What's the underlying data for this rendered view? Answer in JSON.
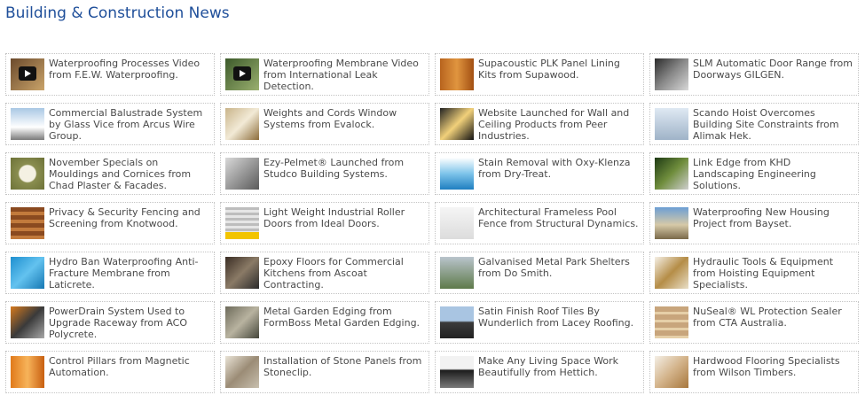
{
  "page": {
    "title": "Building & Construction News"
  },
  "items": [
    {
      "text": "Waterproofing Processes Video from F.E.W. Waterproofing.",
      "thumb": "video-thumb",
      "bg": "linear-gradient(135deg,#6b4a2c,#caa46a)"
    },
    {
      "text": "Waterproofing Membrane Video from International Leak Detection.",
      "thumb": "video-thumb",
      "bg": "linear-gradient(135deg,#3c5a2a,#9bb070)"
    },
    {
      "text": "Supacoustic PLK Panel Lining Kits from Supawood.",
      "thumb": "panel-thumb",
      "bg": "linear-gradient(90deg,#b8641e,#e0953f,#a24f12)"
    },
    {
      "text": "SLM Automatic Door Range from Doorways GILGEN.",
      "thumb": "door-thumb",
      "bg": "linear-gradient(135deg,#2b2b2b,#8a8a8a,#d8d8d8)"
    },
    {
      "text": "Commercial Balustrade System by Glass Vice from Arcus Wire Group.",
      "thumb": "balustrade-thumb",
      "bg": "linear-gradient(180deg,#a9c8e4,#ffffff 60%,#7a7a7a)"
    },
    {
      "text": "Weights and Cords Window Systems from Evalock.",
      "thumb": "window-thumb",
      "bg": "linear-gradient(135deg,#c9b48a,#f2ead6,#8c6c3a)"
    },
    {
      "text": "Website Launched for Wall and Ceiling Products from Peer Industries.",
      "thumb": "website-thumb",
      "bg": "linear-gradient(135deg,#222,#f1d07a 50%,#111)"
    },
    {
      "text": "Scando Hoist Overcomes Building Site Constraints from Alimak Hek.",
      "thumb": "hoist-thumb",
      "bg": "linear-gradient(180deg,#dfe9f3,#9fb3c8)"
    },
    {
      "text": "November Specials on Mouldings and Cornices from Chad Plaster & Facades.",
      "thumb": "moulding-thumb",
      "bg": "radial-gradient(circle,#f4f1e3 35%,#8a8e50 40%,#6d7238)"
    },
    {
      "text": "Ezy-Pelmet® Launched from Studco Building Systems.",
      "thumb": "pelmet-thumb",
      "bg": "linear-gradient(135deg,#d9d9d9,#5a5a5a)"
    },
    {
      "text": "Stain Removal with Oxy-Klenza from Dry-Treat.",
      "thumb": "product-thumb",
      "bg": "linear-gradient(180deg,#ffffff,#7ec4ea 50%,#1f7fc0)"
    },
    {
      "text": "Link Edge from KHD Landscaping Engineering Solutions.",
      "thumb": "edge-thumb",
      "bg": "linear-gradient(135deg,#1e3a14,#6f8d3c,#cfcfcf)"
    },
    {
      "text": "Privacy & Security Fencing and Screening from Knotwood.",
      "thumb": "fence-thumb",
      "bg": "repeating-linear-gradient(180deg,#8a4a20 0 5px,#c27a3c 5px 9px)"
    },
    {
      "text": "Light Weight Industrial Roller Doors from Ideal Doors.",
      "thumb": "roller-thumb",
      "bg": "repeating-linear-gradient(180deg,#bdbdbd 0 3px,#e6e6e6 3px 6px)"
    },
    {
      "text": "Architectural Frameless Pool Fence from Structural Dynamics.",
      "thumb": "pool-thumb",
      "bg": "linear-gradient(180deg,#f5f5f5,#dcdcdc)"
    },
    {
      "text": "Waterproofing New Housing Project from Bayset.",
      "thumb": "housing-thumb",
      "bg": "linear-gradient(180deg,#6c9fd4,#d6c9a8 55%,#7a6a4a)"
    },
    {
      "text": "Hydro Ban Waterproofing Anti-Fracture Membrane from Laticrete.",
      "thumb": "pool-water-thumb",
      "bg": "linear-gradient(135deg,#1e8fcf,#63c2ef,#1678b3)"
    },
    {
      "text": "Epoxy Floors for Commercial Kitchens from Ascoat Contracting.",
      "thumb": "floor-thumb",
      "bg": "linear-gradient(135deg,#3a2d24,#8a7a66,#2a2a2a)"
    },
    {
      "text": "Galvanised Metal Park Shelters from Do Smith.",
      "thumb": "shelter-thumb",
      "bg": "linear-gradient(180deg,#b9c4cc,#5e7a4a)"
    },
    {
      "text": "Hydraulic Tools & Equipment from Hoisting Equipment Specialists.",
      "thumb": "tools-thumb",
      "bg": "linear-gradient(135deg,#f5f0e6,#b58d47,#e9dfc8)"
    },
    {
      "text": "PowerDrain System Used to Upgrade Raceway from ACO Polycrete.",
      "thumb": "drain-thumb",
      "bg": "linear-gradient(135deg,#d67a1e,#3a3a3a,#a8a8a8)"
    },
    {
      "text": "Metal Garden Edging from FormBoss Metal Garden Edging.",
      "thumb": "garden-thumb",
      "bg": "linear-gradient(135deg,#6d6a5a,#b8b3a0,#44453a)"
    },
    {
      "text": "Satin Finish Roof Tiles By Wunderlich from Lacey Roofing.",
      "thumb": "roof-thumb",
      "bg": "linear-gradient(180deg,#a9c5e2 45%,#3b3b3b 50%,#222)"
    },
    {
      "text": "NuSeal® WL Protection Sealer from CTA Australia.",
      "thumb": "sealer-thumb",
      "bg": "repeating-linear-gradient(180deg,#c8a57c 0 6px,#e6cfa8 6px 9px)"
    },
    {
      "text": "Control Pillars from Magnetic Automation.",
      "thumb": "pillar-thumb",
      "bg": "linear-gradient(90deg,#e07a1a,#f7b35a,#c85f10)"
    },
    {
      "text": "Installation of Stone Panels from Stoneclip.",
      "thumb": "stone-thumb",
      "bg": "linear-gradient(135deg,#e9e3d6,#9b8c76,#c8bfae)"
    },
    {
      "text": "Make Any Living Space Work Beautifully from Hettich.",
      "thumb": "kitchen-thumb",
      "bg": "linear-gradient(180deg,#f2f2f2 40%,#1c1c1c 45%,#7a7a7a)"
    },
    {
      "text": "Hardwood Flooring Specialists from Wilson Timbers.",
      "thumb": "flooring-thumb",
      "bg": "linear-gradient(135deg,#f4efe6,#d3b38a,#a7773d)"
    }
  ]
}
